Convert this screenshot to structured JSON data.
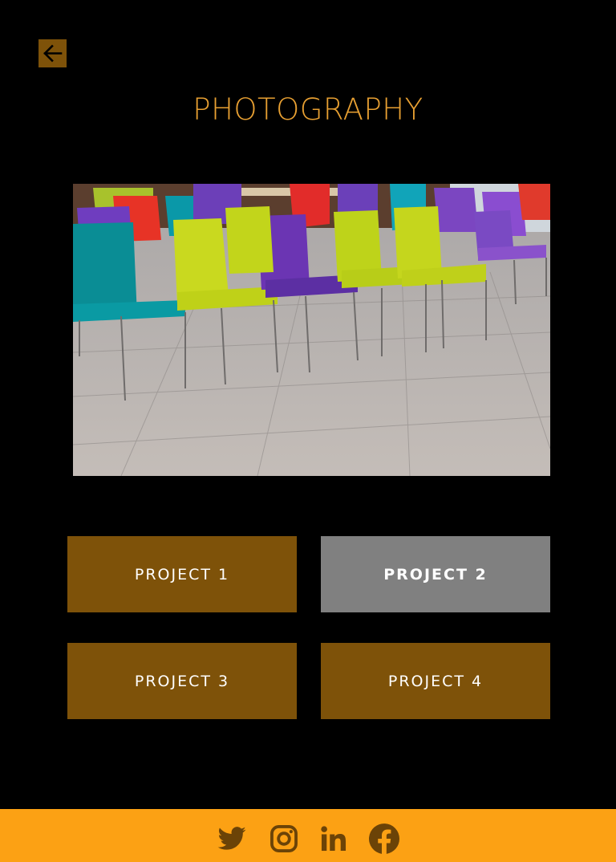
{
  "title": "PHOTOGRAPHY",
  "projects": [
    {
      "label": "PROJECT 1",
      "active": false
    },
    {
      "label": "PROJECT 2",
      "active": true
    },
    {
      "label": "PROJECT 3",
      "active": false
    },
    {
      "label": "PROJECT 4",
      "active": false
    }
  ],
  "icons": {
    "back": "arrow-left-icon",
    "social": [
      "twitter-icon",
      "instagram-icon",
      "linkedin-icon",
      "facebook-icon"
    ]
  },
  "hero_image": "colorful-chairs-photo",
  "colors": {
    "background": "#000000",
    "title": "#e8a032",
    "button": "#7e5209",
    "button_active": "#808080",
    "footer": "#fca114",
    "icon": "#6b4307",
    "text": "#ffffff"
  }
}
